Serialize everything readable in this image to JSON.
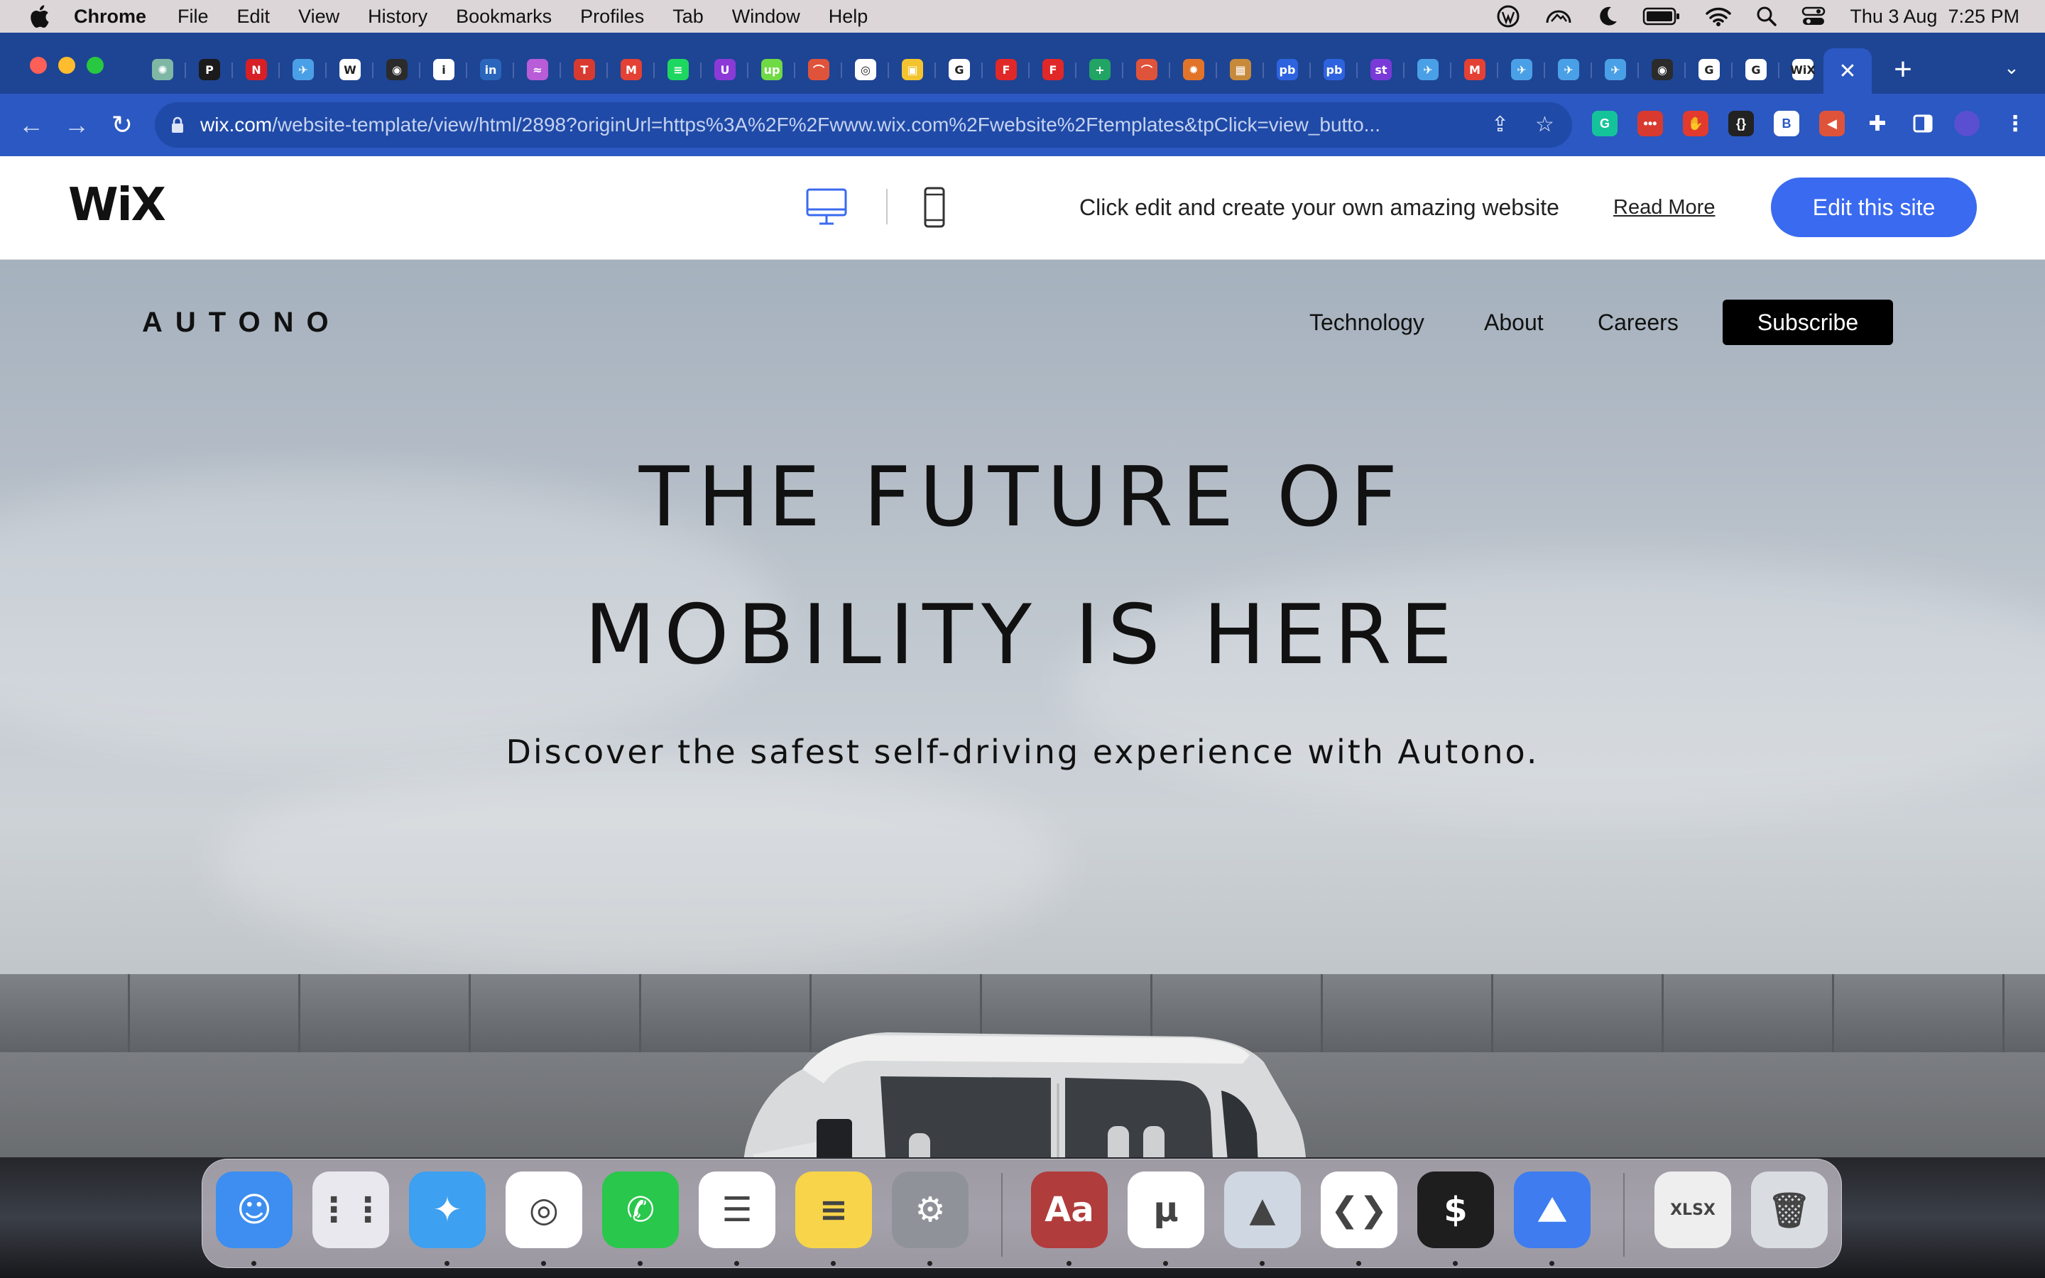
{
  "menubar": {
    "app": "Chrome",
    "items": [
      "File",
      "Edit",
      "View",
      "History",
      "Bookmarks",
      "Profiles",
      "Tab",
      "Window",
      "Help"
    ],
    "datetime": "Thu 3 Aug  7:25 PM"
  },
  "browser": {
    "tab_favicons": [
      {
        "name": "chatgpt",
        "color": "#7fb7a5",
        "glyph": "✺"
      },
      {
        "name": "producthunt",
        "color": "#1b1b1b",
        "glyph": "P"
      },
      {
        "name": "netflix",
        "color": "#d81f26",
        "glyph": "N"
      },
      {
        "name": "swift-bird",
        "color": "#4aa0e6",
        "glyph": "✈"
      },
      {
        "name": "wix",
        "color": "#ffffff",
        "glyph": "W"
      },
      {
        "name": "github",
        "color": "#2b2b2b",
        "glyph": "◉"
      },
      {
        "name": "info",
        "color": "#ffffff",
        "glyph": "i"
      },
      {
        "name": "linkedin",
        "color": "#2a66bc",
        "glyph": "in"
      },
      {
        "name": "wave",
        "color": "#b85cd8",
        "glyph": "≈"
      },
      {
        "name": "tt",
        "color": "#d83a2f",
        "glyph": "T"
      },
      {
        "name": "gmail",
        "color": "#e44134",
        "glyph": "M"
      },
      {
        "name": "spotify",
        "color": "#1ed760",
        "glyph": "≡"
      },
      {
        "name": "u-purple",
        "color": "#8b3ad8",
        "glyph": "U"
      },
      {
        "name": "upwork",
        "color": "#6fda44",
        "glyph": "up"
      },
      {
        "name": "boat",
        "color": "#e0533b",
        "glyph": "⌒"
      },
      {
        "name": "chrome",
        "color": "#ffffff",
        "glyph": "◎"
      },
      {
        "name": "notes-yellow",
        "color": "#f4c430",
        "glyph": "▣"
      },
      {
        "name": "google",
        "color": "#ffffff",
        "glyph": "G"
      },
      {
        "name": "flipboard-1",
        "color": "#e12828",
        "glyph": "F"
      },
      {
        "name": "flipboard-2",
        "color": "#e12828",
        "glyph": "F"
      },
      {
        "name": "sheets-plus",
        "color": "#21a464",
        "glyph": "+"
      },
      {
        "name": "boat-2",
        "color": "#e0533b",
        "glyph": "⌒"
      },
      {
        "name": "gear-orange",
        "color": "#e2742a",
        "glyph": "✹"
      },
      {
        "name": "photo",
        "color": "#c78a3b",
        "glyph": "▦"
      },
      {
        "name": "pb-1",
        "color": "#2e63e0",
        "glyph": "pb"
      },
      {
        "name": "pb-2",
        "color": "#2e63e0",
        "glyph": "pb"
      },
      {
        "name": "st",
        "color": "#7a3ad8",
        "glyph": "st"
      },
      {
        "name": "swift-bird-2",
        "color": "#4aa0e6",
        "glyph": "✈"
      },
      {
        "name": "gmail-2",
        "color": "#e44134",
        "glyph": "M"
      },
      {
        "name": "swift-bird-3",
        "color": "#4aa0e6",
        "glyph": "✈"
      },
      {
        "name": "swift-bird-4",
        "color": "#4aa0e6",
        "glyph": "✈"
      },
      {
        "name": "swift-bird-5",
        "color": "#4aa0e6",
        "glyph": "✈"
      },
      {
        "name": "github-2",
        "color": "#2b2b2b",
        "glyph": "◉"
      },
      {
        "name": "google-2",
        "color": "#ffffff",
        "glyph": "G"
      },
      {
        "name": "google-3",
        "color": "#ffffff",
        "glyph": "G"
      },
      {
        "name": "wix-2",
        "color": "#ffffff",
        "glyph": "WiX"
      }
    ],
    "url_host": "wix.com",
    "url_rest": "/website-template/view/html/2898?originUrl=https%3A%2F%2Fwww.wix.com%2Fwebsite%2Ftemplates&tpClick=view_butto...",
    "extensions": [
      {
        "name": "grammarly",
        "color": "#15c39a",
        "glyph": "G"
      },
      {
        "name": "dots-red",
        "color": "#d83a2f",
        "glyph": "•••"
      },
      {
        "name": "stop-hand",
        "color": "#e23a2f",
        "glyph": "✋"
      },
      {
        "name": "json",
        "color": "#222222",
        "glyph": "{}"
      },
      {
        "name": "bold-b",
        "color": "#ffffff",
        "glyph": "B"
      },
      {
        "name": "megaphone",
        "color": "#e0533b",
        "glyph": "◀"
      }
    ]
  },
  "wix_bar": {
    "logo": "WiX",
    "message": "Click edit and create your own amazing website",
    "read_more": "Read More",
    "edit_button": "Edit this site"
  },
  "site": {
    "brand": "AUTONO",
    "nav": [
      "Technology",
      "About",
      "Careers"
    ],
    "subscribe": "Subscribe",
    "hero_line1": "THE FUTURE OF",
    "hero_line2": "MOBILITY IS HERE",
    "subtitle": "Discover the safest self-driving experience with Autono."
  },
  "dock": [
    {
      "name": "finder",
      "color": "#3d8ef0",
      "glyph": "☺"
    },
    {
      "name": "launchpad",
      "color": "#e8e8ee",
      "glyph": "⋮⋮"
    },
    {
      "name": "safari",
      "color": "#3da0f0",
      "glyph": "✦"
    },
    {
      "name": "chrome",
      "color": "#ffffff",
      "glyph": "◎"
    },
    {
      "name": "whatsapp",
      "color": "#29c74b",
      "glyph": "✆"
    },
    {
      "name": "reminders",
      "color": "#ffffff",
      "glyph": "☰"
    },
    {
      "name": "notes",
      "color": "#f8d44a",
      "glyph": "≡"
    },
    {
      "name": "system-settings",
      "color": "#8f9399",
      "glyph": "⚙"
    },
    {
      "name": "dictionary",
      "color": "#b13c3c",
      "glyph": "Aa"
    },
    {
      "name": "utorrent",
      "color": "#ffffff",
      "glyph": "µ"
    },
    {
      "name": "preview",
      "color": "#cfd8e2",
      "glyph": "▲"
    },
    {
      "name": "vscode",
      "color": "#ffffff",
      "glyph": "❮❯"
    },
    {
      "name": "terminal",
      "color": "#1e1e1e",
      "glyph": "$"
    },
    {
      "name": "nordvpn",
      "color": "#3e7cf0",
      "glyph": "⛰"
    },
    {
      "name": "xlsx-file",
      "color": "#eeeeee",
      "glyph": "XLSX"
    },
    {
      "name": "trash",
      "color": "#d9dde2",
      "glyph": "🗑"
    }
  ]
}
